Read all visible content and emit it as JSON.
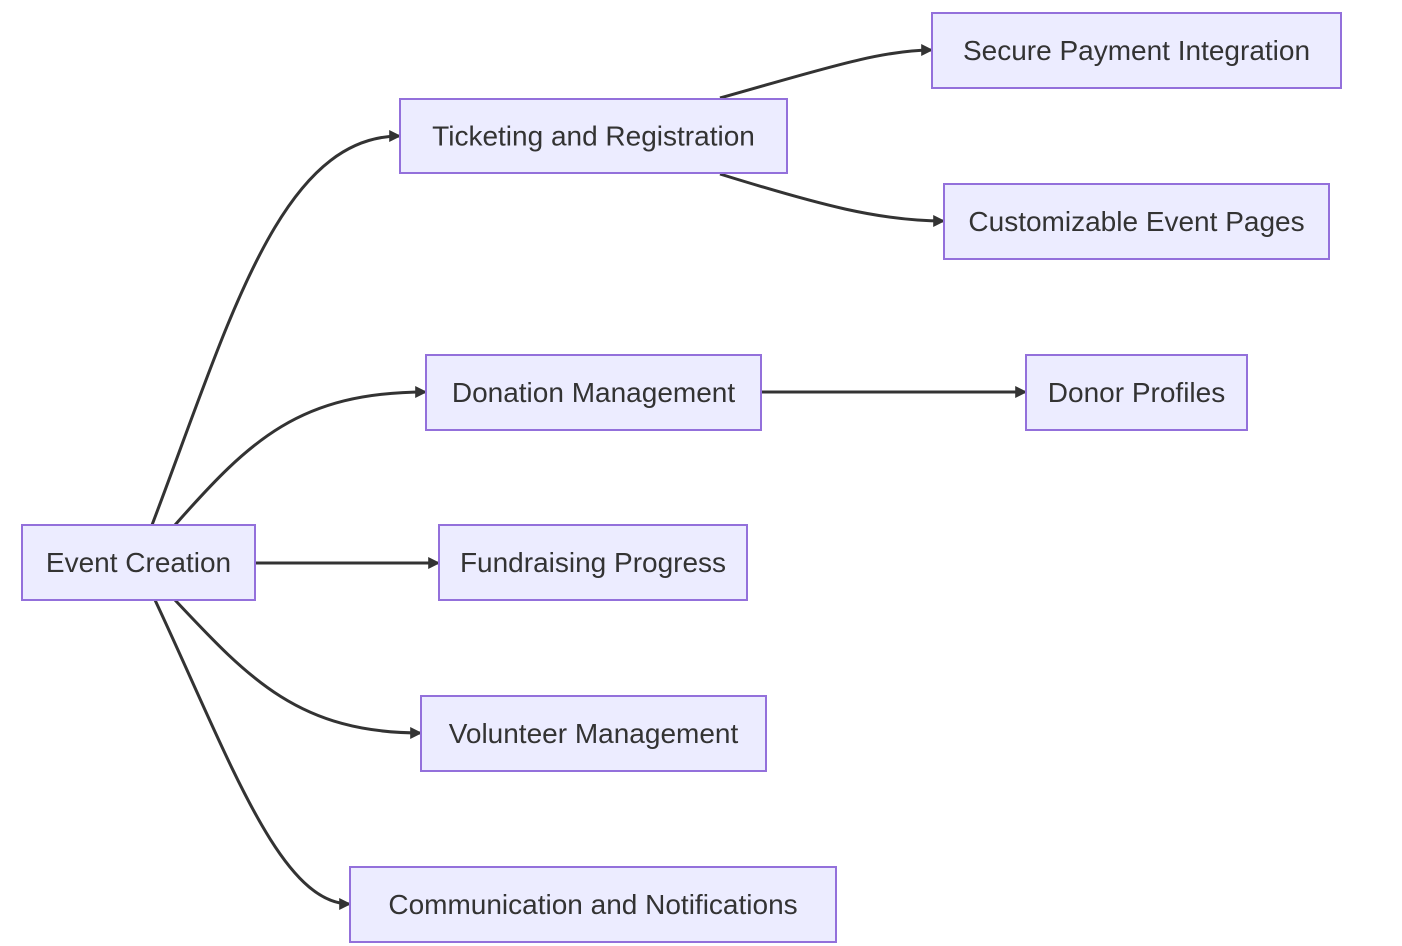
{
  "diagram": {
    "type": "flowchart",
    "direction": "left-to-right",
    "colors": {
      "node_fill": "#ECECFF",
      "node_stroke": "#9370DB",
      "text": "#333333",
      "edge": "#333333"
    },
    "nodes": {
      "event_creation": "Event Creation",
      "ticketing": "Ticketing and Registration",
      "donation": "Donation Management",
      "fundraising": "Fundraising Progress",
      "volunteer": "Volunteer Management",
      "communication": "Communication and Notifications",
      "secure_payment": "Secure Payment Integration",
      "custom_pages": "Customizable Event Pages",
      "donor_profiles": "Donor Profiles"
    },
    "edges": [
      {
        "from": "Event Creation",
        "to": "Ticketing and Registration"
      },
      {
        "from": "Event Creation",
        "to": "Donation Management"
      },
      {
        "from": "Event Creation",
        "to": "Fundraising Progress"
      },
      {
        "from": "Event Creation",
        "to": "Volunteer Management"
      },
      {
        "from": "Event Creation",
        "to": "Communication and Notifications"
      },
      {
        "from": "Ticketing and Registration",
        "to": "Secure Payment Integration"
      },
      {
        "from": "Ticketing and Registration",
        "to": "Customizable Event Pages"
      },
      {
        "from": "Donation Management",
        "to": "Donor Profiles"
      }
    ]
  }
}
